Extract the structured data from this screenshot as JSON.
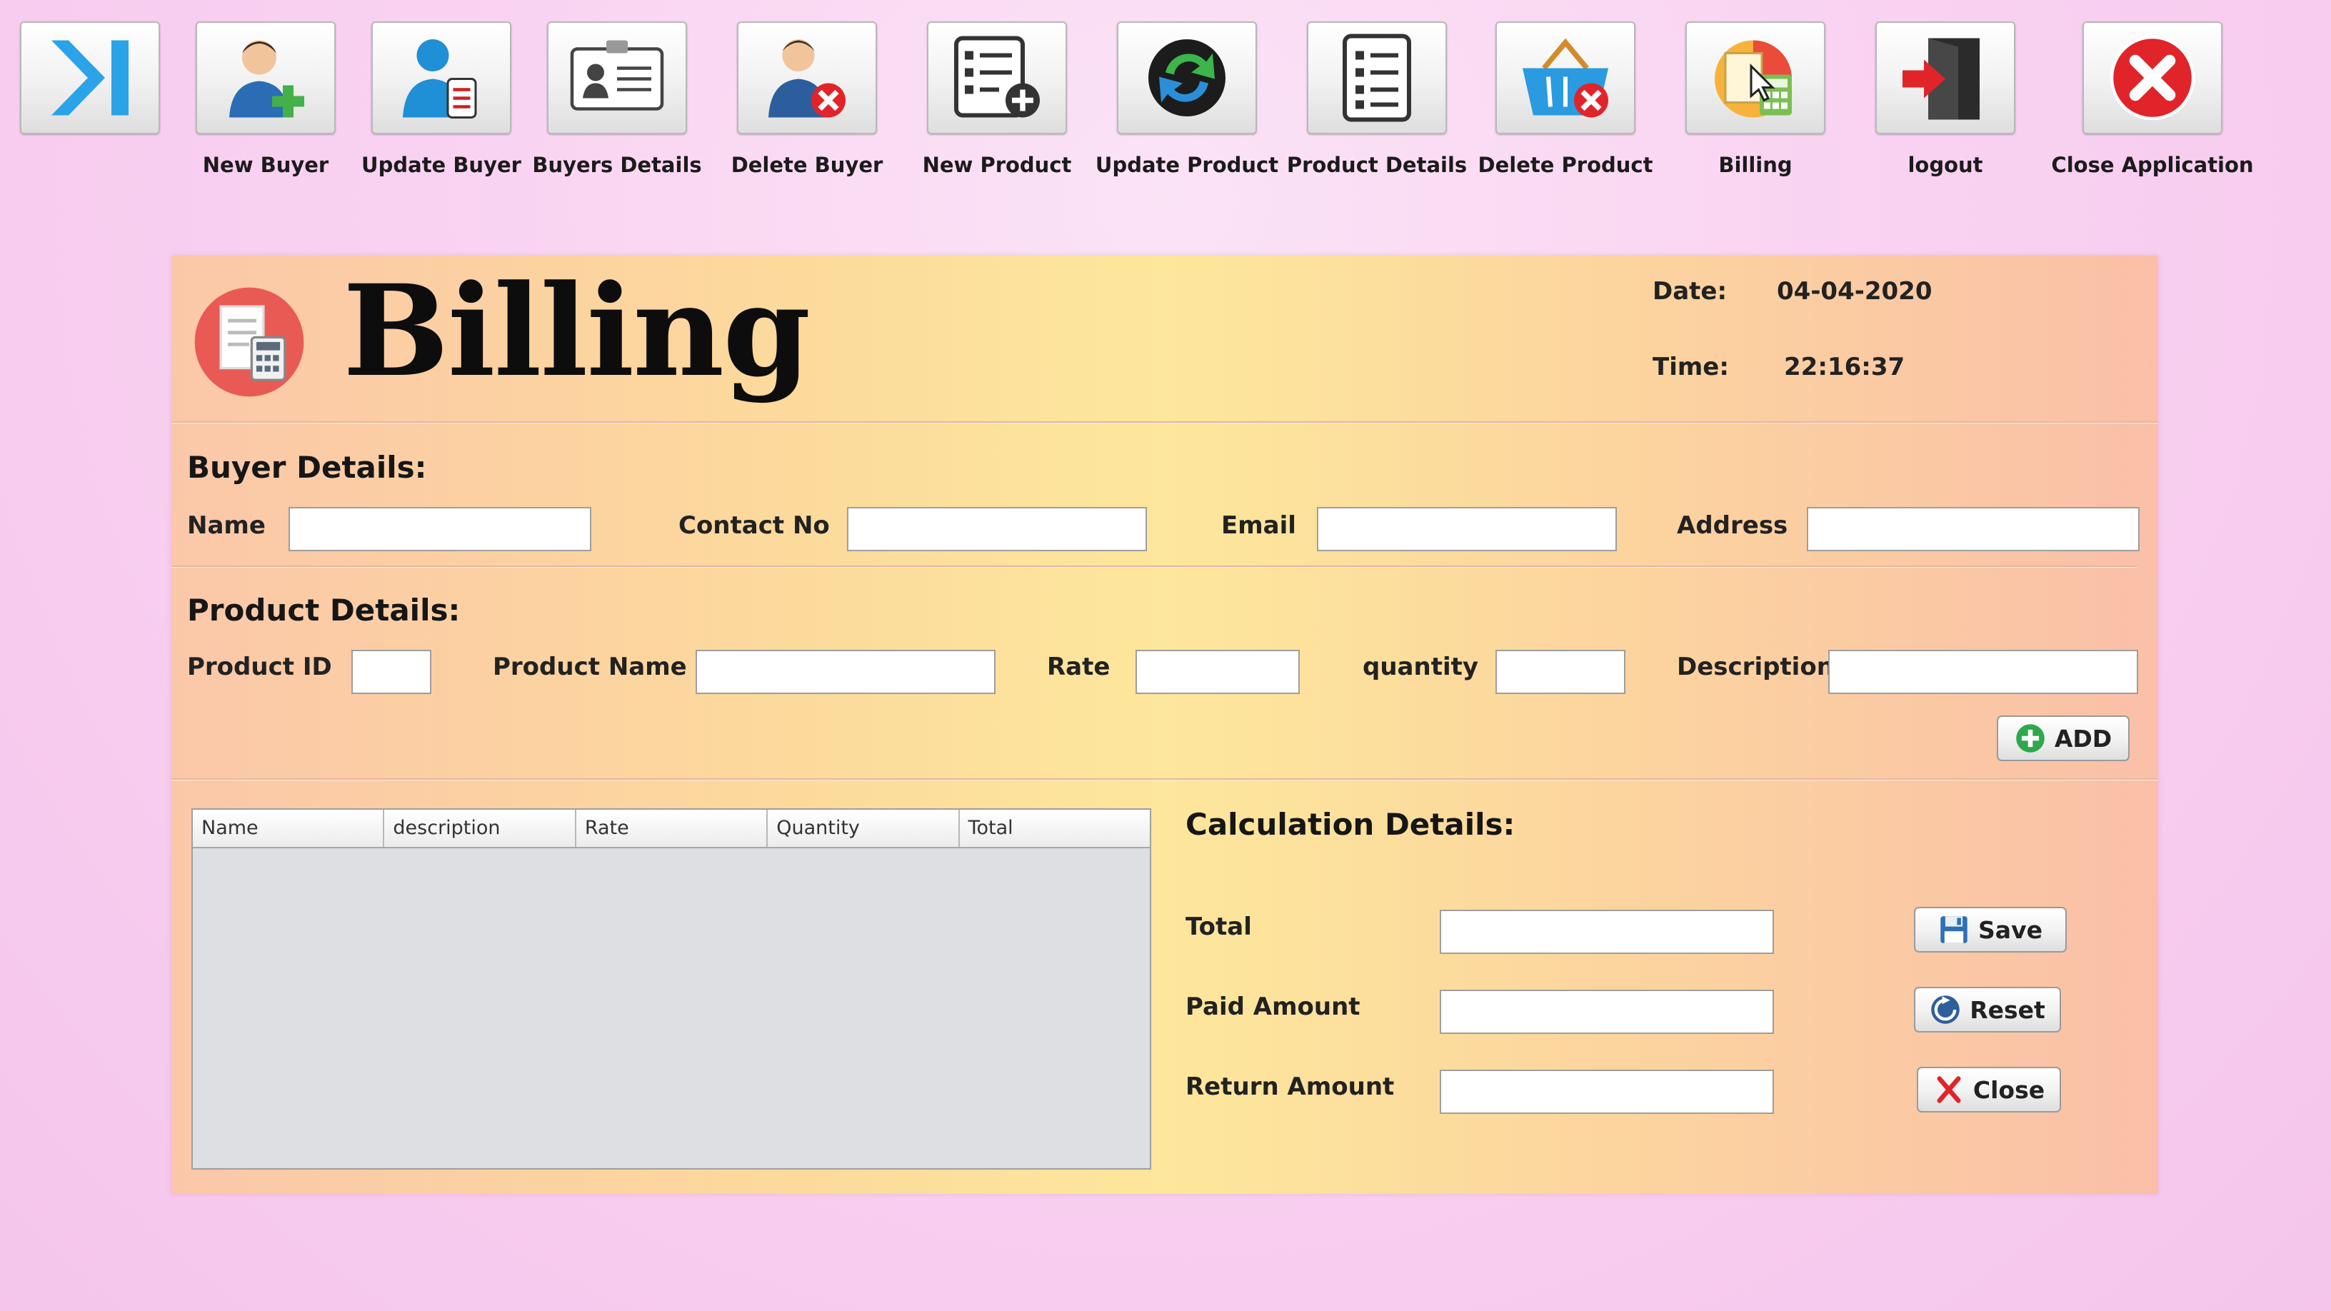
{
  "toolbar": {
    "items": [
      {
        "label": "",
        "icon": "skip-forward-icon"
      },
      {
        "label": "New Buyer",
        "icon": "add-user-icon"
      },
      {
        "label": "Update Buyer",
        "icon": "update-user-icon"
      },
      {
        "label": "Buyers Details",
        "icon": "id-card-icon"
      },
      {
        "label": "Delete Buyer",
        "icon": "delete-user-icon"
      },
      {
        "label": "New Product",
        "icon": "add-list-icon"
      },
      {
        "label": "Update Product",
        "icon": "sync-icon"
      },
      {
        "label": "Product Details",
        "icon": "list-icon"
      },
      {
        "label": "Delete Product",
        "icon": "delete-basket-icon"
      },
      {
        "label": "Billing",
        "icon": "billing-icon"
      },
      {
        "label": "logout",
        "icon": "logout-door-icon"
      },
      {
        "label": "Close Application",
        "icon": "close-circle-icon"
      }
    ]
  },
  "header": {
    "title": "Billing",
    "date_label": "Date:",
    "date_value": "04-04-2020",
    "time_label": "Time:",
    "time_value": "22:16:37"
  },
  "buyer": {
    "section_label": "Buyer Details:",
    "name_label": "Name",
    "name_value": "",
    "contact_label": "Contact No",
    "contact_value": "",
    "email_label": "Email",
    "email_value": "",
    "address_label": "Address",
    "address_value": ""
  },
  "product": {
    "section_label": "Product Details:",
    "id_label": "Product ID",
    "id_value": "",
    "name_label": "Product Name",
    "name_value": "",
    "rate_label": "Rate",
    "rate_value": "",
    "quantity_label": "quantity",
    "quantity_value": "",
    "description_label": "Description",
    "description_value": "",
    "add_label": "ADD"
  },
  "table": {
    "columns": [
      "Name",
      "description",
      "Rate",
      "Quantity",
      "Total"
    ],
    "rows": []
  },
  "calculation": {
    "section_label": "Calculation Details:",
    "total_label": "Total",
    "total_value": "",
    "paid_label": "Paid Amount",
    "paid_value": "",
    "return_label": "Return Amount",
    "return_value": "",
    "save_label": "Save",
    "reset_label": "Reset",
    "close_label": "Close"
  },
  "colors": {
    "accent_red": "#e0242a",
    "accent_blue": "#1f8fd6",
    "add_green": "#2ea84a"
  }
}
